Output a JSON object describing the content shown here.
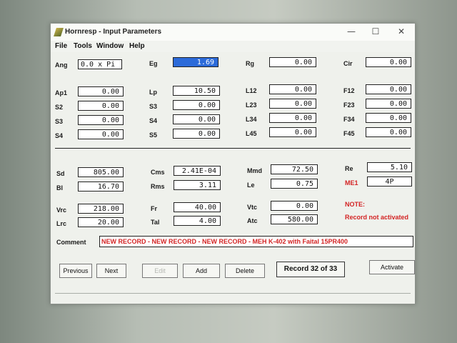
{
  "window": {
    "title": "Hornresp - Input Parameters",
    "controls": {
      "minimize": "—",
      "maximize": "☐",
      "close": "✕"
    }
  },
  "menu": [
    "File",
    "Tools",
    "Window",
    "Help"
  ],
  "fields": {
    "ang": {
      "label": "Ang",
      "value": "0.0 x Pi"
    },
    "eg": {
      "label": "Eg",
      "value": "1.69"
    },
    "rg": {
      "label": "Rg",
      "value": "0.00"
    },
    "cir": {
      "label": "Cir",
      "value": "0.00"
    },
    "ap1": {
      "label": "Ap1",
      "value": "0.00"
    },
    "lp": {
      "label": "Lp",
      "value": "10.50"
    },
    "l12": {
      "label": "L12",
      "value": "0.00"
    },
    "f12": {
      "label": "F12",
      "value": "0.00"
    },
    "s2": {
      "label": "S2",
      "value": "0.00"
    },
    "s3b": {
      "label": "S3",
      "value": "0.00"
    },
    "l23": {
      "label": "L23",
      "value": "0.00"
    },
    "f23": {
      "label": "F23",
      "value": "0.00"
    },
    "s3": {
      "label": "S3",
      "value": "0.00"
    },
    "s4b": {
      "label": "S4",
      "value": "0.00"
    },
    "l34": {
      "label": "L34",
      "value": "0.00"
    },
    "f34": {
      "label": "F34",
      "value": "0.00"
    },
    "s4": {
      "label": "S4",
      "value": "0.00"
    },
    "s5": {
      "label": "S5",
      "value": "0.00"
    },
    "l45": {
      "label": "L45",
      "value": "0.00"
    },
    "f45": {
      "label": "F45",
      "value": "0.00"
    },
    "sd": {
      "label": "Sd",
      "value": "805.00"
    },
    "cms": {
      "label": "Cms",
      "value": "2.41E-04"
    },
    "mmd": {
      "label": "Mmd",
      "value": "72.50"
    },
    "re": {
      "label": "Re",
      "value": "5.10"
    },
    "bl": {
      "label": "Bl",
      "value": "16.70"
    },
    "rms": {
      "label": "Rms",
      "value": "3.11"
    },
    "le": {
      "label": "Le",
      "value": "0.75"
    },
    "me1": {
      "label": "ME1",
      "value": "4P"
    },
    "vrc": {
      "label": "Vrc",
      "value": "218.00"
    },
    "fr": {
      "label": "Fr",
      "value": "40.00"
    },
    "vtc": {
      "label": "Vtc",
      "value": "0.00"
    },
    "lrc": {
      "label": "Lrc",
      "value": "20.00"
    },
    "tal": {
      "label": "Tal",
      "value": "4.00"
    },
    "atc": {
      "label": "Atc",
      "value": "580.00"
    }
  },
  "note": {
    "label": "NOTE:",
    "text": "Record not activated"
  },
  "comment": {
    "label": "Comment",
    "value": "NEW RECORD - NEW RECORD - NEW RECORD - MEH K-402 with Faital 15PR400"
  },
  "buttons": {
    "previous": "Previous",
    "next": "Next",
    "edit": "Edit",
    "add": "Add",
    "delete": "Delete",
    "record": "Record 32 of 33",
    "activate": "Activate"
  }
}
